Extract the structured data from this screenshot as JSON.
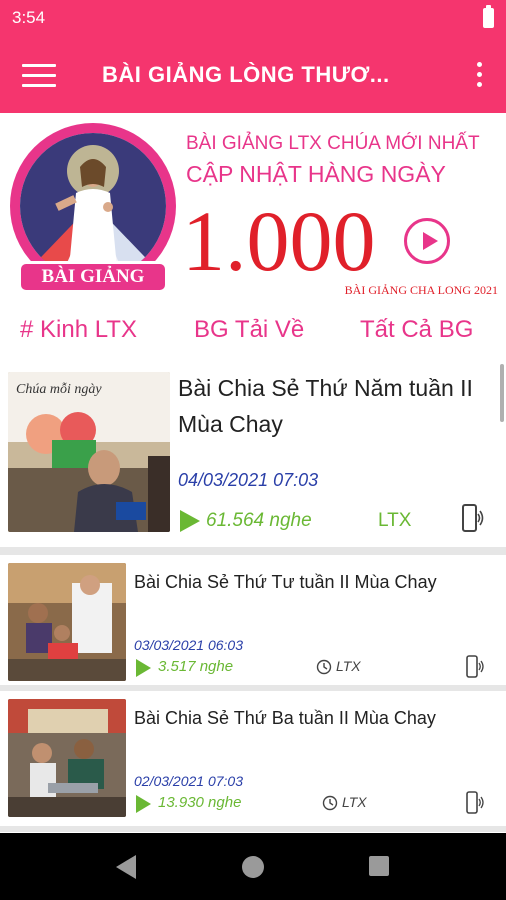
{
  "status_bar": {
    "time": "3:54"
  },
  "app_bar": {
    "title": "BÀI GIẢNG LÒNG THƯƠ..."
  },
  "banner": {
    "logo_text": "BÀI GIẢNG",
    "line1": "BÀI GIẢNG LTX CHÚA MỚI NHẤT",
    "line2": "CẬP NHẬT HÀNG NGÀY",
    "big_number": "1.000",
    "footer": "BÀI GIẢNG CHA LONG 2021"
  },
  "tabs": [
    {
      "label": "# Kinh LTX"
    },
    {
      "label": "BG Tải Về"
    },
    {
      "label": "Tất Cả BG"
    }
  ],
  "items": [
    {
      "title": "Bài Chia Sẻ Thứ Năm tuần II Mùa Chay",
      "date": "04/03/2021 07:03",
      "plays": "61.564 nghe",
      "author": "LTX",
      "thumb_caption": "Chúa mỗi ngày"
    },
    {
      "title": "Bài Chia Sẻ Thứ Tư tuần II Mùa Chay",
      "date": "03/03/2021 06:03",
      "plays": "3.517 nghe",
      "author": "LTX"
    },
    {
      "title": "Bài Chia Sẻ Thứ Ba tuần II Mùa Chay",
      "date": "02/03/2021 07:03",
      "plays": "13.930 nghe",
      "author": "LTX"
    }
  ],
  "colors": {
    "primary": "#f5356e",
    "accent": "#e8358a",
    "number": "#e0202a",
    "date": "#2a3fa8",
    "plays": "#6ab834"
  },
  "icons": [
    "menu-icon",
    "more-vert-icon",
    "play-circle-icon",
    "play-icon",
    "clock-icon",
    "phone-audio-icon",
    "back-icon",
    "home-icon",
    "recent-apps-icon",
    "battery-icon"
  ]
}
